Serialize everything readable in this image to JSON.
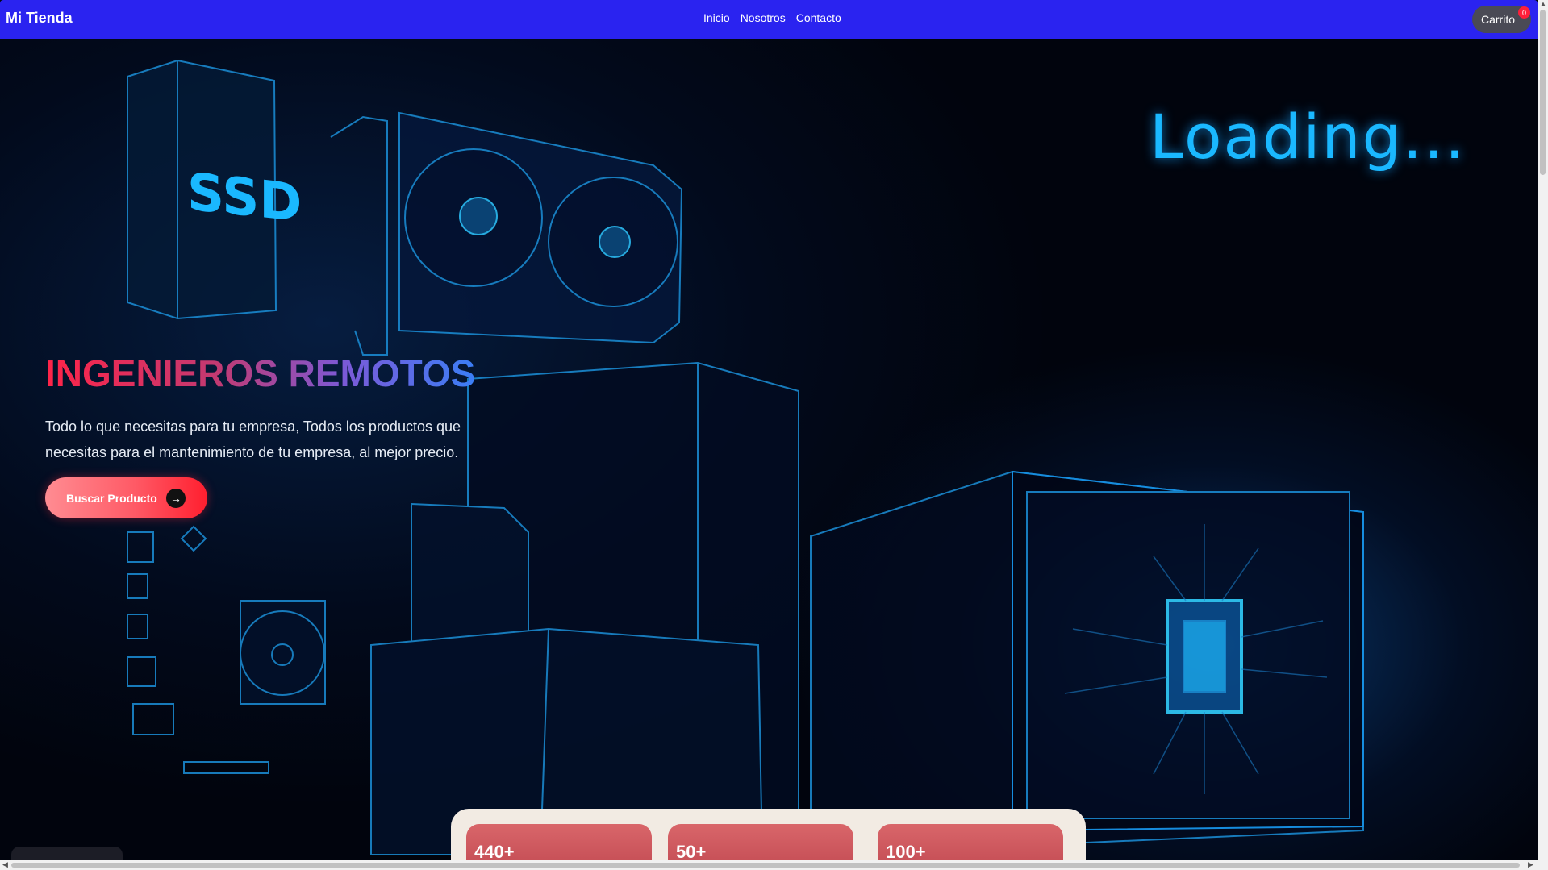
{
  "navbar": {
    "brand": "Mi Tienda",
    "links": [
      "Inicio",
      "Nosotros",
      "Contacto"
    ],
    "cart_label": "Carrito",
    "cart_count": "0"
  },
  "hero": {
    "background_text": "Loading...",
    "ssd_label": "SSD",
    "title": "INGENIEROS REMOTOS",
    "description": "Todo lo que necesitas para tu empresa, Todos los productos que necesitas para el mantenimiento de tu empresa, al mejor precio.",
    "button_label": "Buscar Producto",
    "button_icon": "arrow-right-icon"
  },
  "stats": [
    "440+",
    "50+",
    "100+"
  ],
  "colors": {
    "navbar": "#2a23f0",
    "accent_red": "#ff1f2f",
    "cart_badge": "#ff1f3a",
    "neon_blue": "#1ab8ff",
    "stats_panel": "#f2ebe3"
  }
}
